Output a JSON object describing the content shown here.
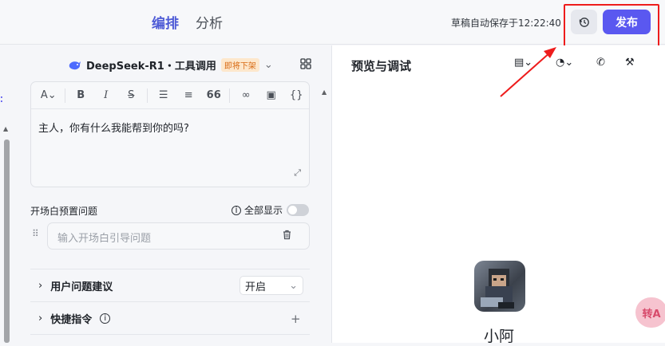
{
  "header": {
    "tabs": [
      {
        "label": "编排",
        "active": true
      },
      {
        "label": "分析",
        "active": false
      }
    ],
    "draft_status": "草稿自动保存于12:22:40",
    "publish_label": "发布",
    "accent_color": "#5a58f0",
    "history_icon": "history-icon"
  },
  "left": {
    "model_name": "DeepSeek-R1・工具调用",
    "model_badge": "即将下架",
    "editor": {
      "toolbar_icons": [
        "text-style-icon",
        "bold-icon",
        "italic-icon",
        "strikethrough-icon",
        "bullet-list-icon",
        "numbered-list-icon",
        "quote-icon",
        "link-icon",
        "image-icon",
        "variable-icon"
      ],
      "content": "主人，你有什么我能帮到你的吗?"
    },
    "preset_questions_label": "开场白预置问题",
    "show_all_label": "全部显示",
    "show_all_enabled": false,
    "question_placeholder": "输入开场白引导问题",
    "sections": [
      {
        "label": "用户问题建议",
        "value": "开启"
      },
      {
        "label": "快捷指令"
      }
    ]
  },
  "right": {
    "title": "预览与调试",
    "bot_name": "小阿",
    "icons": [
      "document-settings-icon",
      "voice-icon",
      "phone-icon",
      "wrench-icon"
    ],
    "float_label": "转A"
  }
}
